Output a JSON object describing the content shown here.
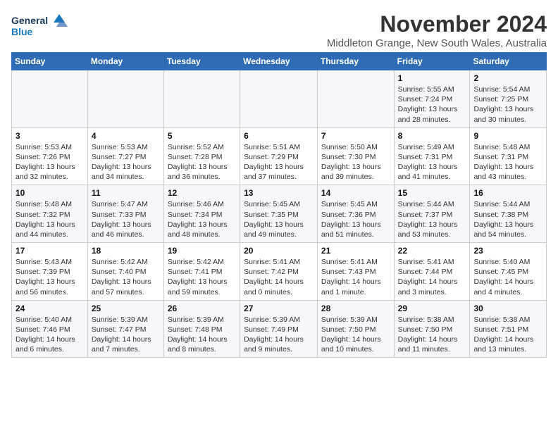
{
  "logo": {
    "line1": "General",
    "line2": "Blue"
  },
  "title": "November 2024",
  "location": "Middleton Grange, New South Wales, Australia",
  "weekdays": [
    "Sunday",
    "Monday",
    "Tuesday",
    "Wednesday",
    "Thursday",
    "Friday",
    "Saturday"
  ],
  "weeks": [
    [
      {
        "day": "",
        "info": ""
      },
      {
        "day": "",
        "info": ""
      },
      {
        "day": "",
        "info": ""
      },
      {
        "day": "",
        "info": ""
      },
      {
        "day": "",
        "info": ""
      },
      {
        "day": "1",
        "info": "Sunrise: 5:55 AM\nSunset: 7:24 PM\nDaylight: 13 hours\nand 28 minutes."
      },
      {
        "day": "2",
        "info": "Sunrise: 5:54 AM\nSunset: 7:25 PM\nDaylight: 13 hours\nand 30 minutes."
      }
    ],
    [
      {
        "day": "3",
        "info": "Sunrise: 5:53 AM\nSunset: 7:26 PM\nDaylight: 13 hours\nand 32 minutes."
      },
      {
        "day": "4",
        "info": "Sunrise: 5:53 AM\nSunset: 7:27 PM\nDaylight: 13 hours\nand 34 minutes."
      },
      {
        "day": "5",
        "info": "Sunrise: 5:52 AM\nSunset: 7:28 PM\nDaylight: 13 hours\nand 36 minutes."
      },
      {
        "day": "6",
        "info": "Sunrise: 5:51 AM\nSunset: 7:29 PM\nDaylight: 13 hours\nand 37 minutes."
      },
      {
        "day": "7",
        "info": "Sunrise: 5:50 AM\nSunset: 7:30 PM\nDaylight: 13 hours\nand 39 minutes."
      },
      {
        "day": "8",
        "info": "Sunrise: 5:49 AM\nSunset: 7:31 PM\nDaylight: 13 hours\nand 41 minutes."
      },
      {
        "day": "9",
        "info": "Sunrise: 5:48 AM\nSunset: 7:31 PM\nDaylight: 13 hours\nand 43 minutes."
      }
    ],
    [
      {
        "day": "10",
        "info": "Sunrise: 5:48 AM\nSunset: 7:32 PM\nDaylight: 13 hours\nand 44 minutes."
      },
      {
        "day": "11",
        "info": "Sunrise: 5:47 AM\nSunset: 7:33 PM\nDaylight: 13 hours\nand 46 minutes."
      },
      {
        "day": "12",
        "info": "Sunrise: 5:46 AM\nSunset: 7:34 PM\nDaylight: 13 hours\nand 48 minutes."
      },
      {
        "day": "13",
        "info": "Sunrise: 5:45 AM\nSunset: 7:35 PM\nDaylight: 13 hours\nand 49 minutes."
      },
      {
        "day": "14",
        "info": "Sunrise: 5:45 AM\nSunset: 7:36 PM\nDaylight: 13 hours\nand 51 minutes."
      },
      {
        "day": "15",
        "info": "Sunrise: 5:44 AM\nSunset: 7:37 PM\nDaylight: 13 hours\nand 53 minutes."
      },
      {
        "day": "16",
        "info": "Sunrise: 5:44 AM\nSunset: 7:38 PM\nDaylight: 13 hours\nand 54 minutes."
      }
    ],
    [
      {
        "day": "17",
        "info": "Sunrise: 5:43 AM\nSunset: 7:39 PM\nDaylight: 13 hours\nand 56 minutes."
      },
      {
        "day": "18",
        "info": "Sunrise: 5:42 AM\nSunset: 7:40 PM\nDaylight: 13 hours\nand 57 minutes."
      },
      {
        "day": "19",
        "info": "Sunrise: 5:42 AM\nSunset: 7:41 PM\nDaylight: 13 hours\nand 59 minutes."
      },
      {
        "day": "20",
        "info": "Sunrise: 5:41 AM\nSunset: 7:42 PM\nDaylight: 14 hours\nand 0 minutes."
      },
      {
        "day": "21",
        "info": "Sunrise: 5:41 AM\nSunset: 7:43 PM\nDaylight: 14 hours\nand 1 minute."
      },
      {
        "day": "22",
        "info": "Sunrise: 5:41 AM\nSunset: 7:44 PM\nDaylight: 14 hours\nand 3 minutes."
      },
      {
        "day": "23",
        "info": "Sunrise: 5:40 AM\nSunset: 7:45 PM\nDaylight: 14 hours\nand 4 minutes."
      }
    ],
    [
      {
        "day": "24",
        "info": "Sunrise: 5:40 AM\nSunset: 7:46 PM\nDaylight: 14 hours\nand 6 minutes."
      },
      {
        "day": "25",
        "info": "Sunrise: 5:39 AM\nSunset: 7:47 PM\nDaylight: 14 hours\nand 7 minutes."
      },
      {
        "day": "26",
        "info": "Sunrise: 5:39 AM\nSunset: 7:48 PM\nDaylight: 14 hours\nand 8 minutes."
      },
      {
        "day": "27",
        "info": "Sunrise: 5:39 AM\nSunset: 7:49 PM\nDaylight: 14 hours\nand 9 minutes."
      },
      {
        "day": "28",
        "info": "Sunrise: 5:39 AM\nSunset: 7:50 PM\nDaylight: 14 hours\nand 10 minutes."
      },
      {
        "day": "29",
        "info": "Sunrise: 5:38 AM\nSunset: 7:50 PM\nDaylight: 14 hours\nand 11 minutes."
      },
      {
        "day": "30",
        "info": "Sunrise: 5:38 AM\nSunset: 7:51 PM\nDaylight: 14 hours\nand 13 minutes."
      }
    ]
  ]
}
